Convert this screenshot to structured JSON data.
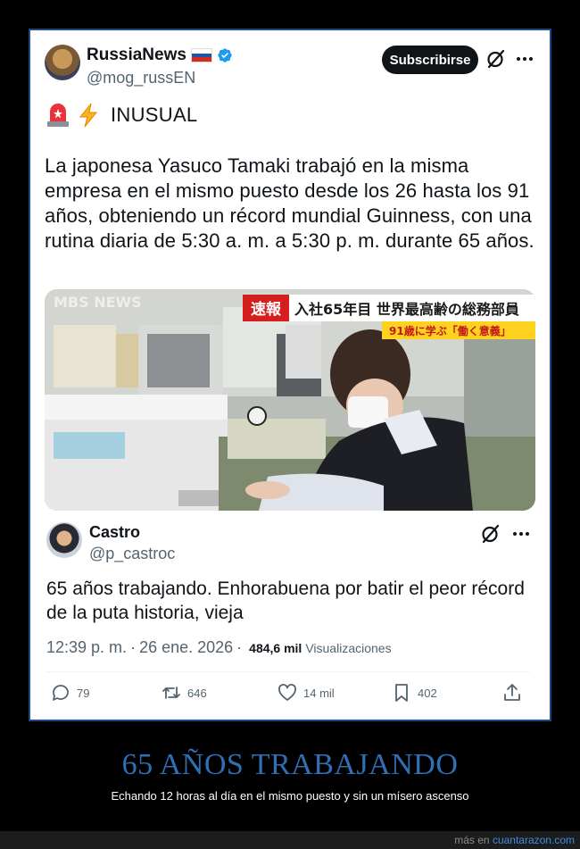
{
  "tweet": {
    "author_name": "RussiaNews",
    "author_handle": "@mog_russEN",
    "subscribe_label": "Subscribirse",
    "tag_text": "INUSUAL",
    "body": "La japonesa Yasuco Tamaki trabajó en la misma empresa en el mismo puesto desde los 26 hasta los 91 años, obteniendo un récord mundial Guinness, con una rutina diaria de 5:30 a. m. a 5:30 p. m. durante 65 años.",
    "media": {
      "broadcaster_logo": "MBS NEWS",
      "banner_tag": "速報",
      "banner_headline": "入社65年目 世界最高齢の総務部員",
      "banner_sub": "91歳に学ぶ「働く意義」"
    },
    "icons": [
      "verified-icon",
      "grok-icon",
      "more-icon",
      "siren-icon",
      "lightning-icon"
    ]
  },
  "reply": {
    "author_name": "Castro",
    "author_handle": "@p_castroc",
    "text": "65 años trabajando. Enhorabuena por batir el peor récord de la puta historia, vieja",
    "time": "12:39 p. m.",
    "date": "26 ene. 2026",
    "views_count": "484,6 mil",
    "views_label": "Visualizaciones",
    "actions": {
      "replies": "79",
      "retweets": "646",
      "likes": "14 mil",
      "bookmarks": "402"
    }
  },
  "caption": {
    "headline": "65 AÑOS TRABAJANDO",
    "subhead": "Echando 12 horas al día en el mismo puesto y sin un mísero ascenso"
  },
  "footer": {
    "prefix": "más en",
    "site": "cuantarazon.com"
  },
  "colors": {
    "frame_border": "#1d4a86",
    "headline": "#2f6fb6",
    "verified": "#1d9bf0",
    "link": "#3d8ce0"
  }
}
